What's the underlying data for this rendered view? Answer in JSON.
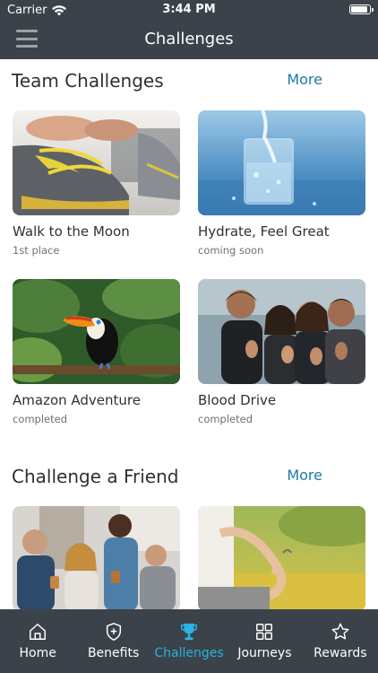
{
  "status_bar": {
    "carrier": "Carrier",
    "time": "3:44 PM"
  },
  "nav": {
    "title": "Challenges",
    "menu_icon": "hamburger-menu-icon"
  },
  "sections": [
    {
      "title": "Team Challenges",
      "more": "More",
      "cards": [
        {
          "name": "Walk to the Moon",
          "status": "1st place",
          "image": "sneaker-lacing-photo"
        },
        {
          "name": "Hydrate, Feel Great",
          "status": "coming soon",
          "image": "water-glass-photo"
        },
        {
          "name": "Amazon Adventure",
          "status": "completed",
          "image": "toucan-photo"
        },
        {
          "name": "Blood Drive",
          "status": "completed",
          "image": "group-thumbs-up-photo"
        }
      ]
    },
    {
      "title": "Challenge a Friend",
      "more": "More",
      "cards": [
        {
          "name": "",
          "status": "",
          "image": "office-coffee-photo"
        },
        {
          "name": "",
          "status": "",
          "image": "meditation-photo"
        }
      ]
    }
  ],
  "tabs": [
    {
      "label": "Home",
      "icon": "home-icon",
      "active": false
    },
    {
      "label": "Benefits",
      "icon": "shield-plus-icon",
      "active": false
    },
    {
      "label": "Challenges",
      "icon": "trophy-icon",
      "active": true
    },
    {
      "label": "Journeys",
      "icon": "grid-icon",
      "active": false
    },
    {
      "label": "Rewards",
      "icon": "star-icon",
      "active": false
    }
  ],
  "colors": {
    "bar": "#3b4249",
    "accent": "#2bb3e3",
    "link": "#1f78a8",
    "text": "#2d3136"
  }
}
